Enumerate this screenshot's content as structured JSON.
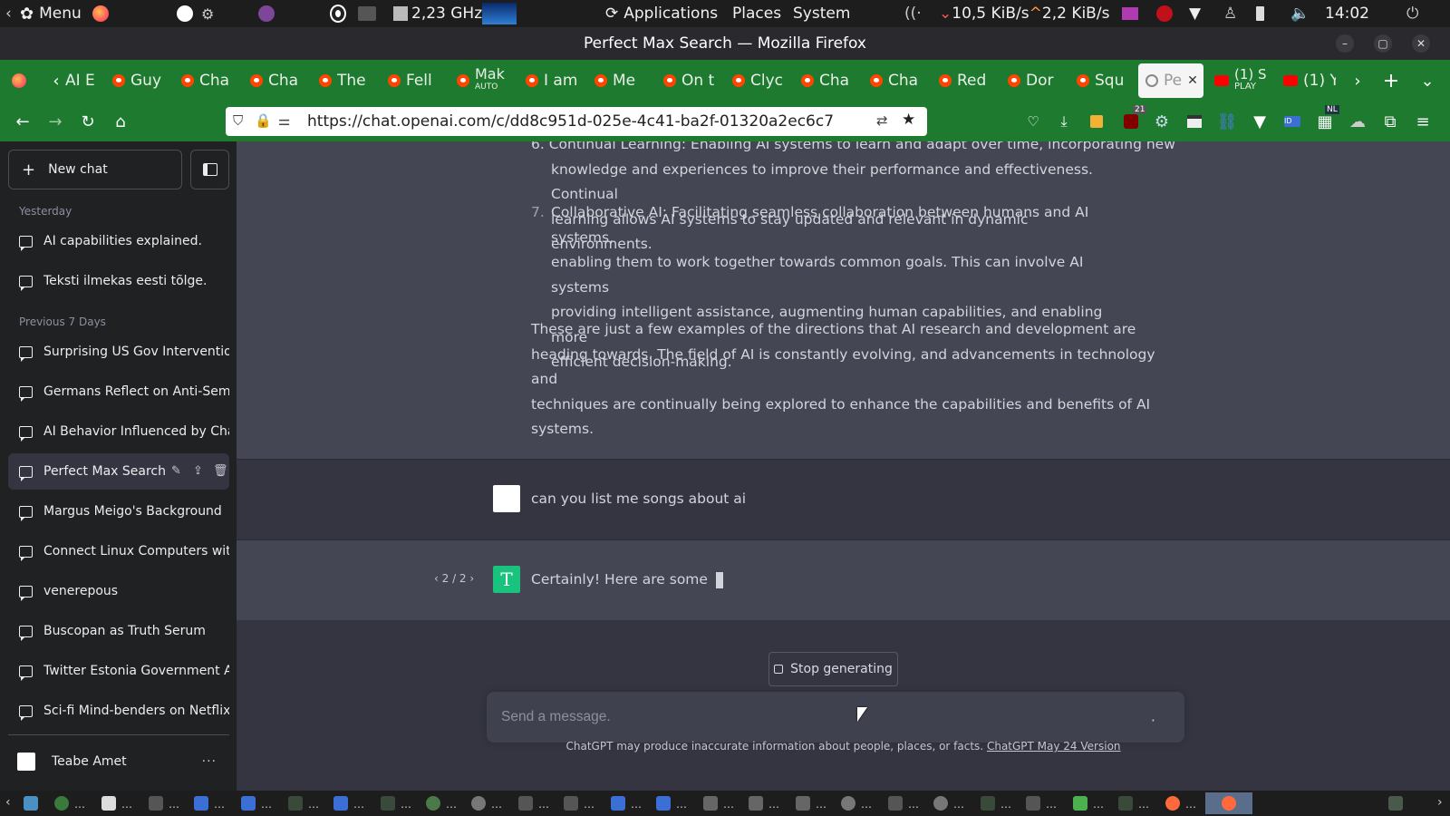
{
  "os_top": {
    "menu_label": "Menu",
    "cpu_freq": "2,23 GHz",
    "applications": "Applications",
    "places": "Places",
    "system": "System",
    "net_down": "10,5 KiB/s",
    "net_up": "2,2 KiB/s",
    "clock": "14:02"
  },
  "window": {
    "title": "Perfect Max Search — Mozilla Firefox"
  },
  "tabs": [
    {
      "label": "AI E"
    },
    {
      "label": "Guy"
    },
    {
      "label": "Cha"
    },
    {
      "label": "Cha"
    },
    {
      "label": "The"
    },
    {
      "label": "Fell"
    },
    {
      "label": "Mak",
      "sub": "AUTO"
    },
    {
      "label": "I am"
    },
    {
      "label": "Me"
    },
    {
      "label": "On t"
    },
    {
      "label": "Clyc"
    },
    {
      "label": "Cha"
    },
    {
      "label": "Cha"
    },
    {
      "label": "Red"
    },
    {
      "label": "Dor"
    },
    {
      "label": "Squ"
    },
    {
      "label": "Pe",
      "active": true
    },
    {
      "label": "(1) S",
      "sub": "PLAY"
    },
    {
      "label": "(1) Y"
    }
  ],
  "navbar": {
    "url": "https://chat.openai.com/c/dd8c951d-025e-4c41-ba2f-01320a2ec6c7",
    "ext_badge": "21",
    "ext_badge2": "NL"
  },
  "sidebar": {
    "new_chat": "New chat",
    "sections": [
      {
        "label": "Yesterday",
        "items": [
          "AI capabilities explained.",
          "Teksti ilmekas eesti tõlge."
        ]
      },
      {
        "label": "Previous 7 Days",
        "items": [
          "Surprising US Gov Intervention",
          "Germans Reflect on Anti-Semiti",
          "AI Behavior Influenced by Chat",
          "Perfect Max Search",
          "Margus Meigo's Background",
          "Connect Linux Computers with",
          "venerepous",
          "Buscopan as Truth Serum",
          "Twitter Estonia Government Acc",
          "Sci-fi Mind-benders on Netflix"
        ]
      }
    ],
    "user_name": "Teabe Amet"
  },
  "conversation": {
    "list_top_partial_line": "6.  Continual Learning: Enabling AI systems to learn and adapt over time, incorporating new",
    "list_item6_rest": [
      "knowledge and experiences to improve their performance and effectiveness. Continual",
      "learning allows AI systems to stay updated and relevant in dynamic environments."
    ],
    "list_item7_number": "7.",
    "list_item7_lines": [
      "Collaborative AI: Facilitating seamless collaboration between humans and AI systems,",
      "enabling them to work together towards common goals. This can involve AI systems",
      "providing intelligent assistance, augmenting human capabilities, and enabling more",
      "efficient decision-making."
    ],
    "closing_lines": [
      "These are just a few examples of the directions that AI research and development are",
      "heading towards. The field of AI is constantly evolving, and advancements in technology and",
      "techniques are continually being explored to enhance the capabilities and benefits of AI",
      "systems."
    ],
    "user_message": "can you list me songs about ai",
    "assistant_reply": "Certainly! Here are some",
    "pager": "2 / 2",
    "assistant_avatar_letter": "T"
  },
  "composer": {
    "stop_label": "Stop generating",
    "placeholder": "Send a message.",
    "disclaimer": "ChatGPT may produce inaccurate information about people, places, or facts.",
    "version_link": "ChatGPT May 24 Version"
  },
  "colors": {
    "tabbar_green": "#1e7a2e",
    "sidebar_bg": "#202123",
    "main_bg": "#343541",
    "ai_msg_bg": "#444654",
    "gpt_green": "#19c37d"
  }
}
